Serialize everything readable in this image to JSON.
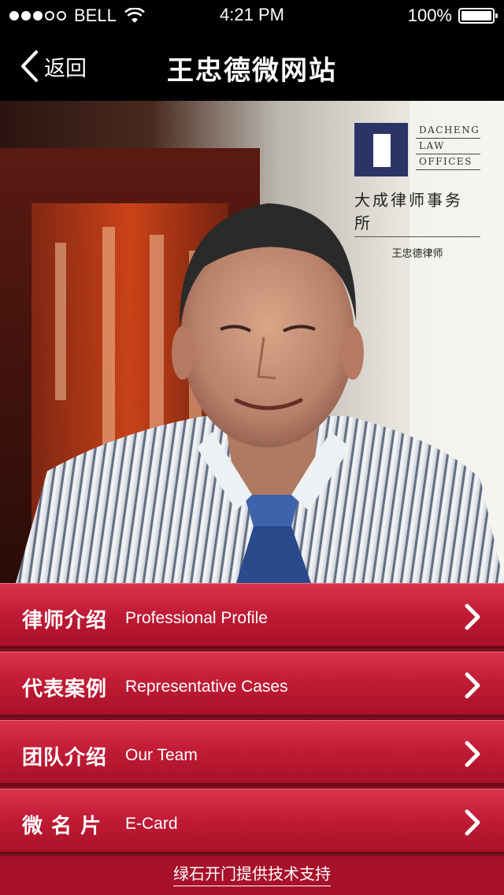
{
  "status_bar": {
    "carrier": "BELL",
    "signal_bars": 3,
    "signal_total": 5,
    "time": "4:21 PM",
    "battery": "100%",
    "battery_level": 1.0,
    "icons": [
      "signal-dots-icon",
      "wifi-icon",
      "battery-icon"
    ]
  },
  "nav": {
    "back_label": "返回",
    "back_icon": "chevron-left-icon",
    "title": "王忠德微网站"
  },
  "hero": {
    "logo": {
      "line1": "DACHENG",
      "line2": "LAW",
      "line3": "OFFICES",
      "firm_cn": "大成律师事务所",
      "lawyer": "王忠德律师"
    }
  },
  "menu": {
    "items": [
      {
        "cn": "律师介绍",
        "en": "Professional Profile"
      },
      {
        "cn": "代表案例",
        "en": "Representative Cases"
      },
      {
        "cn": "团队介绍",
        "en": "Our Team"
      },
      {
        "cn": "微 名 片",
        "en": "E-Card"
      }
    ],
    "chevron_icon": "chevron-right-icon"
  },
  "footer": {
    "text": "绿石开门提供技术支持"
  },
  "colors": {
    "menu_red": "#c21c36",
    "footer_red": "#a8112a",
    "logo_navy": "#2c3466",
    "bar_black": "#000000"
  }
}
